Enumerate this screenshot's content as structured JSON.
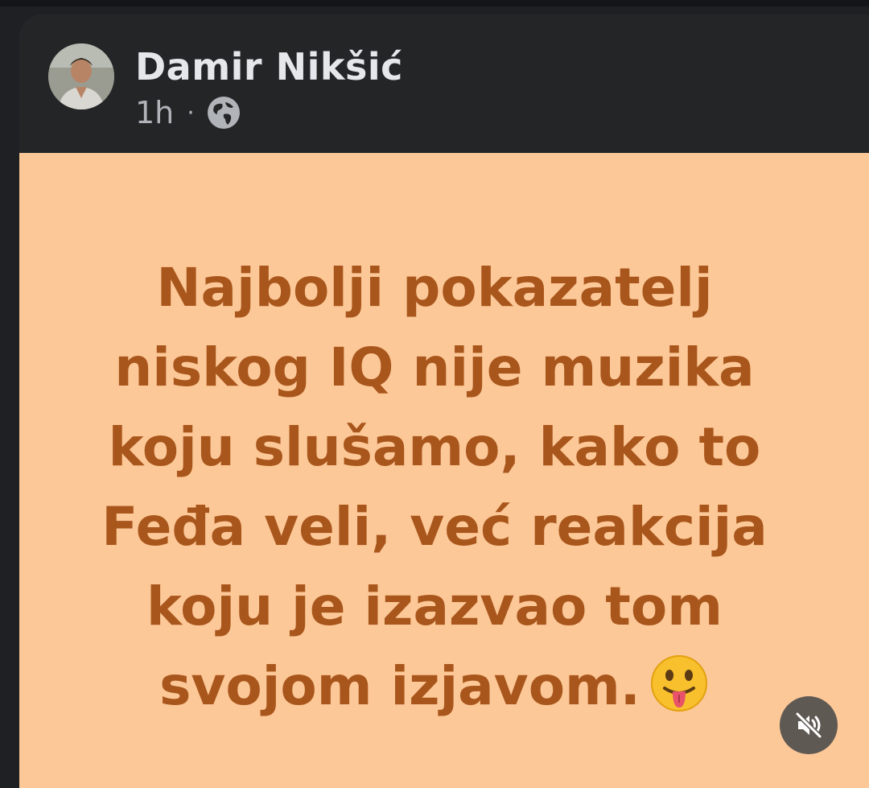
{
  "post": {
    "author": "Damir Nikšić",
    "time": "1h",
    "separator": "·",
    "privacy_icon": "globe-icon",
    "avatar": "avatar-photo",
    "background_color": "#fcc897",
    "text_color": "#a9561c",
    "message_lines": [
      "Najbolji pokazatelj",
      "niskog IQ nije muzika",
      "koju slušamo, kako to",
      "Feđa veli, već reakcija",
      "koju je izazvao tom",
      "svojom izjavom."
    ],
    "emoji": "face-with-tongue-emoji"
  },
  "controls": {
    "mute_icon": "speaker-muted-icon"
  }
}
